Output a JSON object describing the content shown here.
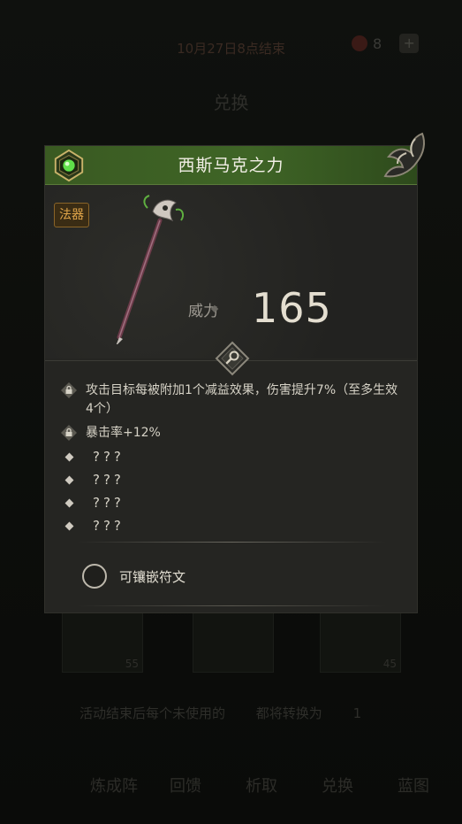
{
  "background": {
    "event_end_text": "10月27日8点结束",
    "resource_count": "8",
    "add_label": "+",
    "exchange_title": "兑换",
    "card_counts": [
      "55",
      "45"
    ],
    "conversion_note": "活动结束后每个未使用的",
    "conversion_tail": "都将转换为",
    "conversion_count": "1",
    "nav_items": [
      "炼成阵",
      "回馈",
      "析取",
      "兑换",
      "蓝图"
    ]
  },
  "modal": {
    "title": "西斯马克之力",
    "type_badge": "法器",
    "power_label": "威力",
    "power_value": "165",
    "attributes": [
      {
        "icon": "lock-icon",
        "text": "攻击目标每被附加1个减益效果，伤害提升7%（至多生效4个）"
      },
      {
        "icon": "lock-icon",
        "text": "暴击率+12%"
      },
      {
        "icon": "diamond-icon",
        "text": "???"
      },
      {
        "icon": "diamond-icon",
        "text": "???"
      },
      {
        "icon": "diamond-icon",
        "text": "???"
      },
      {
        "icon": "diamond-icon",
        "text": "???"
      }
    ],
    "rune_label": "可镶嵌符文"
  },
  "colors": {
    "header_green": "#3f6526",
    "badge_orange": "#e2a64a",
    "panel_bg": "#252522"
  }
}
